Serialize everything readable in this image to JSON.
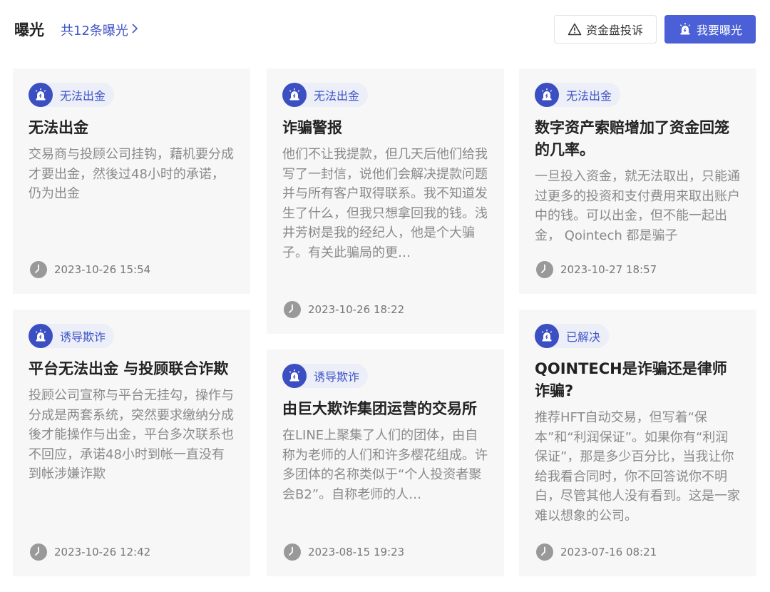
{
  "header": {
    "title": "曝光",
    "count_label": "共12条曝光",
    "complaint_button": "资金盘投诉",
    "expose_button": "我要曝光"
  },
  "columns": [
    [
      {
        "tag": "无法出金",
        "title": "无法出金",
        "body": "交易商与投顾公司挂钩，藉机要分成才要出金，然後过48小时的承诺，仍为出金",
        "time": "2023-10-26 15:54"
      },
      {
        "tag": "诱导欺诈",
        "title": "平台无法出金 与投顾联合诈欺",
        "body": "投顾公司宣称与平台无挂勾，操作与分成是两套系统，突然要求缴纳分成後才能操作与出金，平台多次联系也不回应，承诺48小时到帐一直没有到帐涉嫌诈欺",
        "time": "2023-10-26 12:42"
      }
    ],
    [
      {
        "tag": "无法出金",
        "title": "诈骗警报",
        "body": "他们不让我提款，但几天后他们给我写了一封信，说他们会解决提款问题并与所有客户取得联系。我不知道发生了什么，但我只想拿回我的钱。浅井芳树是我的经纪人，他是个大骗子。有关此骗局的更…",
        "time": "2023-10-26 18:22"
      },
      {
        "tag": "诱导欺诈",
        "title": "由巨大欺诈集团运营的交易所",
        "body": "在LINE上聚集了人们的团体，由自称为老师的人们和许多樱花组成。许多团体的名称类似于“个人投资者聚会B2”。自称老师的人…",
        "time": "2023-08-15 19:23"
      }
    ],
    [
      {
        "tag": "无法出金",
        "title": "数字资产索赔增加了资金回笼的几率。",
        "body": "一旦投入资金，就无法取出，只能通过更多的投资和支付费用来取出账户中的钱。可以出金，但不能一起出金， Qointech 都是骗子",
        "time": "2023-10-27 18:57"
      },
      {
        "tag": "已解决",
        "title": " QOINTECH是诈骗还是律师诈骗?",
        "body": "推荐HFT自动交易，但写着“保本”和“利润保证”。如果你有“利润保证”，那是多少百分比，当我让你给我看合同时，你不回答说你不明白，尽管其他人没有看到。这是一家难以想象的公司。",
        "time": "2023-07-16 08:21"
      }
    ]
  ],
  "colors": {
    "accent": "#4b5fd6",
    "tag_bg": "#eceef8",
    "card_bg": "#f7f7f7"
  },
  "icons": {
    "tag_badge": "alarm-light-icon",
    "time": "clock-icon",
    "complaint": "warning-triangle-icon",
    "chevron": "chevron-right-icon"
  }
}
